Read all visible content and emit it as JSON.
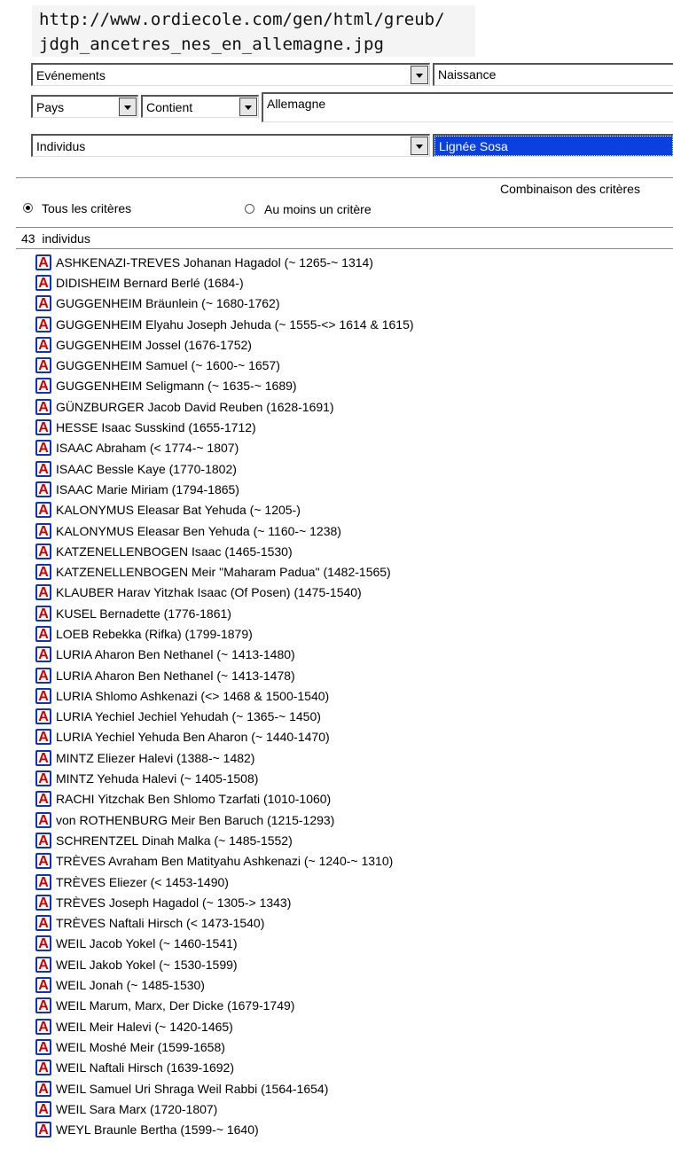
{
  "url_lines": [
    "http://www.ordiecole.com/gen/html/greub/",
    "jdgh_ancetres_nes_en_allemagne.jpg"
  ],
  "filters": {
    "evenements": {
      "value": "Evénements",
      "operand": "Naissance"
    },
    "pays": {
      "value": "Pays",
      "condition": "Contient",
      "text": "Allemagne"
    },
    "individus": {
      "value": "Individus",
      "operand": "Lignée Sosa"
    }
  },
  "combination": {
    "label": "Combinaison des critères",
    "all_label": "Tous les critères",
    "any_label": "Au moins un critère",
    "selected": "all"
  },
  "count": {
    "number": "43",
    "label": "individus"
  },
  "icon": {
    "name": "ancestor-a-icon",
    "glyph": "A",
    "border_color": "#1133bb",
    "glyph_color": "#d00000"
  },
  "individuals": [
    "ASHKENAZI-TREVES Johanan Hagadol (~ 1265-~ 1314)",
    "DIDISHEIM Bernard Berlé (1684-)",
    "GUGGENHEIM Bräunlein (~ 1680-1762)",
    "GUGGENHEIM Elyahu Joseph Jehuda (~ 1555-<> 1614 & 1615)",
    "GUGGENHEIM Jossel (1676-1752)",
    "GUGGENHEIM Samuel (~ 1600-~ 1657)",
    "GUGGENHEIM Seligmann (~ 1635-~ 1689)",
    "GÜNZBURGER Jacob David Reuben (1628-1691)",
    "HESSE Isaac Susskind (1655-1712)",
    "ISAAC Abraham (< 1774-~ 1807)",
    "ISAAC Bessle Kaye (1770-1802)",
    "ISAAC Marie Miriam (1794-1865)",
    "KALONYMUS Eleasar Bat Yehuda (~ 1205-)",
    "KALONYMUS Eleasar Ben Yehuda (~ 1160-~ 1238)",
    "KATZENELLENBOGEN Isaac (1465-1530)",
    "KATZENELLENBOGEN Meir \"Maharam Padua\" (1482-1565)",
    "KLAUBER Harav Yitzhak Isaac (Of Posen) (1475-1540)",
    "KUSEL Bernadette (1776-1861)",
    "LOEB Rebekka (Rifka) (1799-1879)",
    "LURIA Aharon Ben Nethanel (~ 1413-1480)",
    "LURIA Aharon Ben Nethanel (~ 1413-1478)",
    "LURIA Shlomo Ashkenazi (<> 1468 & 1500-1540)",
    "LURIA Yechiel Jechiel Yehudah (~ 1365-~ 1450)",
    "LURIA Yechiel Yehuda Ben Aharon (~ 1440-1470)",
    "MINTZ Eliezer Halevi (1388-~ 1482)",
    "MINTZ Yehuda Halevi (~ 1405-1508)",
    "RACHI Yitzchak Ben Shlomo Tzarfati (1010-1060)",
    "von ROTHENBURG Meir Ben Baruch (1215-1293)",
    "SCHRENTZEL Dinah Malka (~ 1485-1552)",
    "TRÈVES Avraham Ben Matityahu Ashkenazi (~ 1240-~ 1310)",
    "TRÈVES Eliezer (< 1453-1490)",
    "TRÈVES Joseph Hagadol (~ 1305-> 1343)",
    "TRÈVES Naftali Hirsch (< 1473-1540)",
    "WEIL Jacob Yokel (~ 1460-1541)",
    "WEIL Jakob Yokel (~ 1530-1599)",
    "WEIL Jonah (~ 1485-1530)",
    "WEIL Marum, Marx, Der Dicke (1679-1749)",
    "WEIL Meir Halevi (~ 1420-1465)",
    "WEIL Moshé Meir (1599-1658)",
    "WEIL Naftali Hirsch (1639-1692)",
    "WEIL Samuel Uri Shraga Weil  Rabbi (1564-1654)",
    "WEIL Sara Marx (1720-1807)",
    "WEYL Braunle Bertha (1599-~ 1640)"
  ]
}
